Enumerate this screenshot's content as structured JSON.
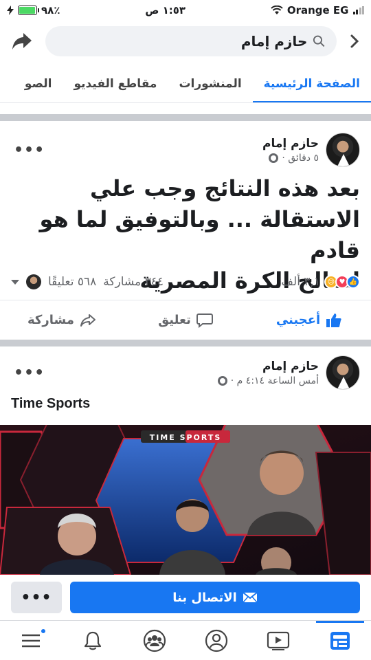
{
  "status_bar": {
    "battery": "٩٨٪",
    "time": "١:٥٣ ص",
    "carrier": "Orange EG"
  },
  "search": {
    "value": "حازم إمام"
  },
  "tabs": [
    {
      "label": "الصفحة الرئيسية"
    },
    {
      "label": "المنشورات"
    },
    {
      "label": "مقاطع الفيديو"
    },
    {
      "label": "الصو"
    }
  ],
  "post1": {
    "author": "حازم إمام",
    "time": "٥ دقائق ·",
    "more": "•••",
    "text_lines": [
      "بعد هذه النتائج وجب علي",
      "الاستقالة ... وبالتوفيق لما هو قادم",
      "لصالح الكرة المصرية"
    ],
    "reactions_count": "٣,١ ألف",
    "shares": "٣٤٤ مشاركة",
    "comments": "٥٦٨ تعليقًا",
    "actions": {
      "like": "أعجبني",
      "comment": "تعليق",
      "share": "مشاركة"
    }
  },
  "post2": {
    "author": "حازم إمام",
    "time": "أمس الساعة ٤:١٤ م ·",
    "more": "•••",
    "text": "Time Sports",
    "media_logo": "TIME SPORTS"
  },
  "cta": {
    "more": "•••",
    "contact": "الاتصال بنا"
  },
  "colors": {
    "accent": "#1877f2",
    "divider": "#c9ccd1"
  }
}
